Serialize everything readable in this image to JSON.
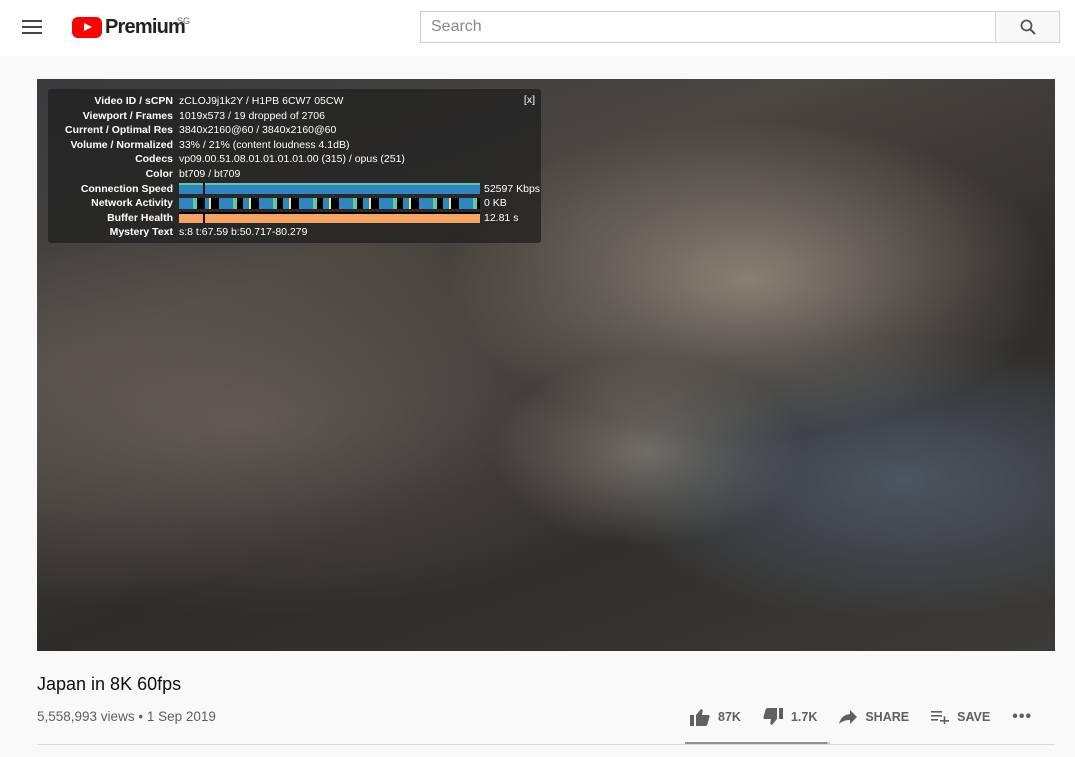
{
  "header": {
    "brand": "Premium",
    "region": "SG",
    "search_placeholder": "Search"
  },
  "stats": {
    "close": "[x]",
    "rows": [
      {
        "label": "Video ID / sCPN",
        "value": "zCLOJ9j1k2Y / H1PB 6CW7 05CW"
      },
      {
        "label": "Viewport / Frames",
        "value": "1019x573 / 19 dropped of 2706"
      },
      {
        "label": "Current / Optimal Res",
        "value": "3840x2160@60 / 3840x2160@60"
      },
      {
        "label": "Volume / Normalized",
        "value": "33% / 21% (content loudness 4.1dB)"
      },
      {
        "label": "Codecs",
        "value": "vp09.00.51.08.01.01.01.01.00 (315) / opus (251)"
      },
      {
        "label": "Color",
        "value": "bt709 / bt709"
      },
      {
        "label": "Connection Speed",
        "value": "52597 Kbps"
      },
      {
        "label": "Network Activity",
        "value": "0 KB"
      },
      {
        "label": "Buffer Health",
        "value": "12.81 s"
      },
      {
        "label": "Mystery Text",
        "value": "s:8 t:67.59 b:50.717-80.279"
      }
    ],
    "colors": {
      "speed": "#2e86c1",
      "activity": "#2e86c1",
      "buffer": "#f4a460"
    }
  },
  "video": {
    "title": "Japan in 8K 60fps",
    "views": "5,558,993 views",
    "date": "1 Sep 2019"
  },
  "actions": {
    "likes": "87K",
    "dislikes": "1.7K",
    "share": "SHARE",
    "save": "SAVE",
    "like_ratio": 0.98
  }
}
